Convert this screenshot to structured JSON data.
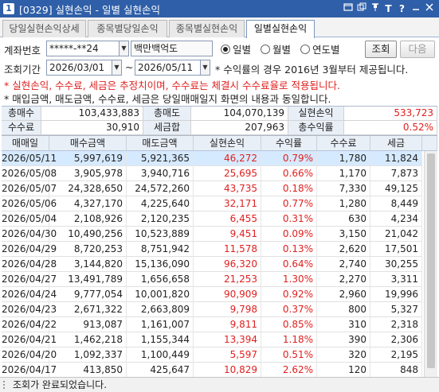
{
  "window": {
    "number": "1",
    "title": "[0329] 실현손익 - 일별 실현손익"
  },
  "titlebar_icons": [
    "window-icon",
    "copy-icon",
    "pin-icon",
    "font-icon",
    "help-icon",
    "minimize-icon",
    "close-icon"
  ],
  "tabs": [
    {
      "label": "당일실현손익상세",
      "active": false
    },
    {
      "label": "종목별당일손익",
      "active": false
    },
    {
      "label": "종목별실현손익",
      "active": false
    },
    {
      "label": "일별실현손익",
      "active": true
    }
  ],
  "form": {
    "account_label": "계좌번호",
    "account_value": "*****-**24",
    "account_name": "백만백억도",
    "period_options": [
      "일별",
      "월별",
      "연도별"
    ],
    "period_selected": "일별",
    "query_button": "조회",
    "next_button": "다음",
    "range_label": "조회기간",
    "start_date": "2026/03/01",
    "end_date": "2026/05/11",
    "range_sep": "~",
    "note1": "* 수익률의 경우 2016년 3월부터 제공됩니다.",
    "note2": "* 실현손익, 수수료, 세금은 추정치이며, 수수료는 체결시 수수료율로 적용됩니다.",
    "note3": "* 매입금액, 매도금액, 수수료, 세금은 당일매매일지 화면의 내용과 동일합니다."
  },
  "summary": {
    "total_buy_label": "총매수",
    "total_buy": "103,433,883",
    "total_sell_label": "총매도",
    "total_sell": "104,070,139",
    "realized_label": "실현손익",
    "realized": "533,723",
    "fee_label": "수수료",
    "fee": "30,910",
    "tax_label": "세금합",
    "tax": "207,963",
    "total_return_label": "총수익률",
    "total_return": "0.52%"
  },
  "table": {
    "headers": [
      "매매일",
      "매수금액",
      "매도금액",
      "실현손익",
      "수익률",
      "수수료",
      "세금"
    ],
    "rows": [
      [
        "2026/05/11",
        "5,997,619",
        "5,921,365",
        "46,272",
        "0.79%",
        "1,780",
        "11,824"
      ],
      [
        "2026/05/08",
        "3,905,978",
        "3,940,716",
        "25,695",
        "0.66%",
        "1,170",
        "7,873"
      ],
      [
        "2026/05/07",
        "24,328,650",
        "24,572,260",
        "43,735",
        "0.18%",
        "7,330",
        "49,125"
      ],
      [
        "2026/05/06",
        "4,327,170",
        "4,225,640",
        "32,171",
        "0.77%",
        "1,280",
        "8,449"
      ],
      [
        "2026/05/04",
        "2,108,926",
        "2,120,235",
        "6,455",
        "0.31%",
        "630",
        "4,234"
      ],
      [
        "2026/04/30",
        "10,490,256",
        "10,523,889",
        "9,451",
        "0.09%",
        "3,150",
        "21,042"
      ],
      [
        "2026/04/29",
        "8,720,253",
        "8,751,942",
        "11,578",
        "0.13%",
        "2,620",
        "17,501"
      ],
      [
        "2026/04/28",
        "3,144,820",
        "15,136,090",
        "96,320",
        "0.64%",
        "2,740",
        "30,255"
      ],
      [
        "2026/04/27",
        "13,491,789",
        "1,656,658",
        "21,253",
        "1.30%",
        "2,270",
        "3,311"
      ],
      [
        "2026/04/24",
        "9,777,054",
        "10,001,820",
        "90,909",
        "0.92%",
        "2,960",
        "19,996"
      ],
      [
        "2026/04/23",
        "2,671,322",
        "2,663,809",
        "9,798",
        "0.37%",
        "800",
        "5,327"
      ],
      [
        "2026/04/22",
        "913,087",
        "1,161,007",
        "9,811",
        "0.85%",
        "310",
        "2,318"
      ],
      [
        "2026/04/21",
        "1,462,218",
        "1,155,344",
        "13,394",
        "1.18%",
        "390",
        "2,306"
      ],
      [
        "2026/04/20",
        "1,092,337",
        "1,100,449",
        "5,597",
        "0.51%",
        "320",
        "2,195"
      ],
      [
        "2026/04/17",
        "413,850",
        "425,647",
        "10,829",
        "2.62%",
        "120",
        "848"
      ]
    ],
    "selected_row": 0
  },
  "status": {
    "message": "조회가 완료되었습니다."
  },
  "colors": {
    "profit": "#e02020",
    "title_bar": "#2f5fa8",
    "header_bg": "#e9eff7",
    "selected_row": "#d6eaff"
  }
}
